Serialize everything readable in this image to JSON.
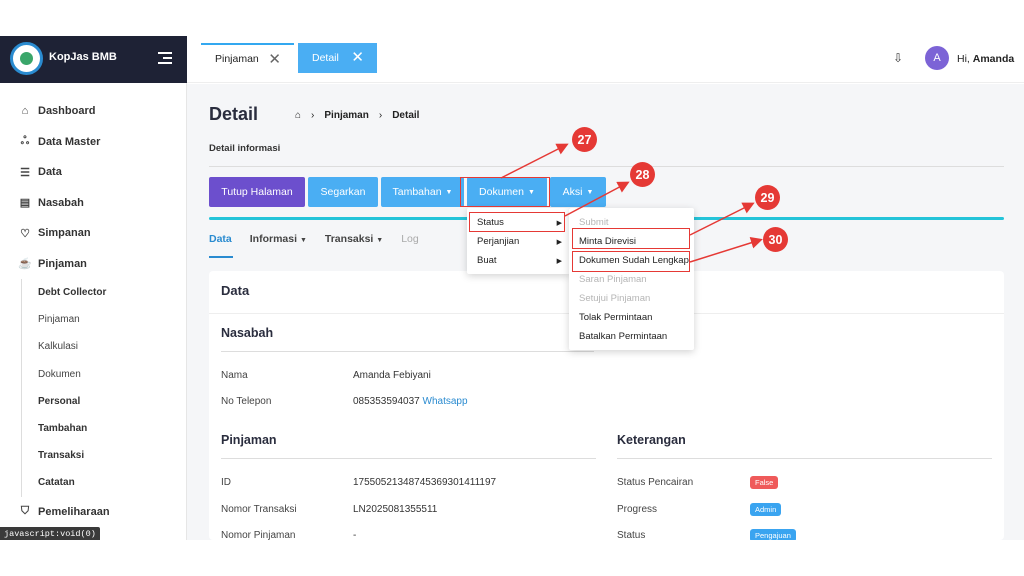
{
  "sidebar": {
    "brand": "KopJas BMB",
    "items": [
      {
        "label": "Dashboard",
        "icon": "home-icon",
        "glyph": "⌂"
      },
      {
        "label": "Data Master",
        "icon": "sitemap-icon",
        "glyph": "ஃ"
      },
      {
        "label": "Data",
        "icon": "server-icon",
        "glyph": "☰"
      },
      {
        "label": "Nasabah",
        "icon": "id-card-icon",
        "glyph": "▤"
      },
      {
        "label": "Simpanan",
        "icon": "piggy-bank-icon",
        "glyph": "♡"
      },
      {
        "label": "Pinjaman",
        "icon": "hand-coin-icon",
        "glyph": "☕"
      }
    ],
    "sub_items": [
      {
        "label": "Debt Collector",
        "bold": true
      },
      {
        "label": "Pinjaman",
        "bold": false
      },
      {
        "label": "Kalkulasi",
        "bold": false
      },
      {
        "label": "Dokumen",
        "bold": false
      },
      {
        "label": "Personal",
        "bold": true
      },
      {
        "label": "Tambahan",
        "bold": true
      },
      {
        "label": "Transaksi",
        "bold": true
      },
      {
        "label": "Catatan",
        "bold": true
      }
    ],
    "last_item": {
      "label": "Pemeliharaan",
      "icon": "shield-icon",
      "glyph": "⛉"
    }
  },
  "tabs": [
    {
      "label": "Pinjaman"
    },
    {
      "label": "Detail"
    }
  ],
  "header": {
    "avatar_letter": "A",
    "greeting": "Hi,",
    "user": "Amanda"
  },
  "page": {
    "title": "Detail",
    "breadcrumb": [
      "Pinjaman",
      "Detail"
    ],
    "section_label": "Detail informasi"
  },
  "toolbar": {
    "close": "Tutup Halaman",
    "refresh": "Segarkan",
    "add": "Tambahan",
    "document": "Dokumen",
    "action": "Aksi"
  },
  "subtabs": [
    "Data",
    "Informasi",
    "Transaksi",
    "Log"
  ],
  "card": {
    "title": "Data",
    "nasabah": {
      "heading": "Nasabah",
      "rows": [
        {
          "label": "Nama",
          "value": "Amanda Febiyani"
        },
        {
          "label": "No Telepon",
          "value": "085353594037",
          "link": "Whatsapp"
        }
      ]
    },
    "pinjaman": {
      "heading": "Pinjaman",
      "rows": [
        {
          "label": "ID",
          "value": "17550521348745369301411197"
        },
        {
          "label": "Nomor Transaksi",
          "value": "LN2025081355511"
        },
        {
          "label": "Nomor Pinjaman",
          "value": "-"
        }
      ]
    },
    "keterangan": {
      "heading": "Keterangan",
      "rows": [
        {
          "label": "Status Pencairan",
          "badge": "False",
          "color": "#ef5a5a"
        },
        {
          "label": "Progress",
          "badge": "Admin",
          "color": "#3aa4f0"
        },
        {
          "label": "Status",
          "badge": "Pengajuan",
          "color": "#3aa4f0"
        }
      ]
    }
  },
  "dropdown_dokumen": [
    "Status",
    "Perjanjian",
    "Buat"
  ],
  "dropdown_status": [
    {
      "label": "Submit",
      "disabled": true
    },
    {
      "label": "Minta Direvisi",
      "disabled": false
    },
    {
      "label": "Dokumen Sudah Lengkap",
      "disabled": false
    },
    {
      "label": "Saran Pinjaman",
      "disabled": true
    },
    {
      "label": "Setujui Pinjaman",
      "disabled": true
    },
    {
      "label": "Tolak Permintaan",
      "disabled": false
    },
    {
      "label": "Batalkan Permintaan",
      "disabled": false
    }
  ],
  "annotations": [
    "27",
    "28",
    "29",
    "30"
  ],
  "status_bar": "javascript:void(0)",
  "colors": {
    "sidebar_header": "#1e2235",
    "primary": "#4aaef3",
    "purple": "#6c4fcd",
    "annotation": "#e53935"
  }
}
